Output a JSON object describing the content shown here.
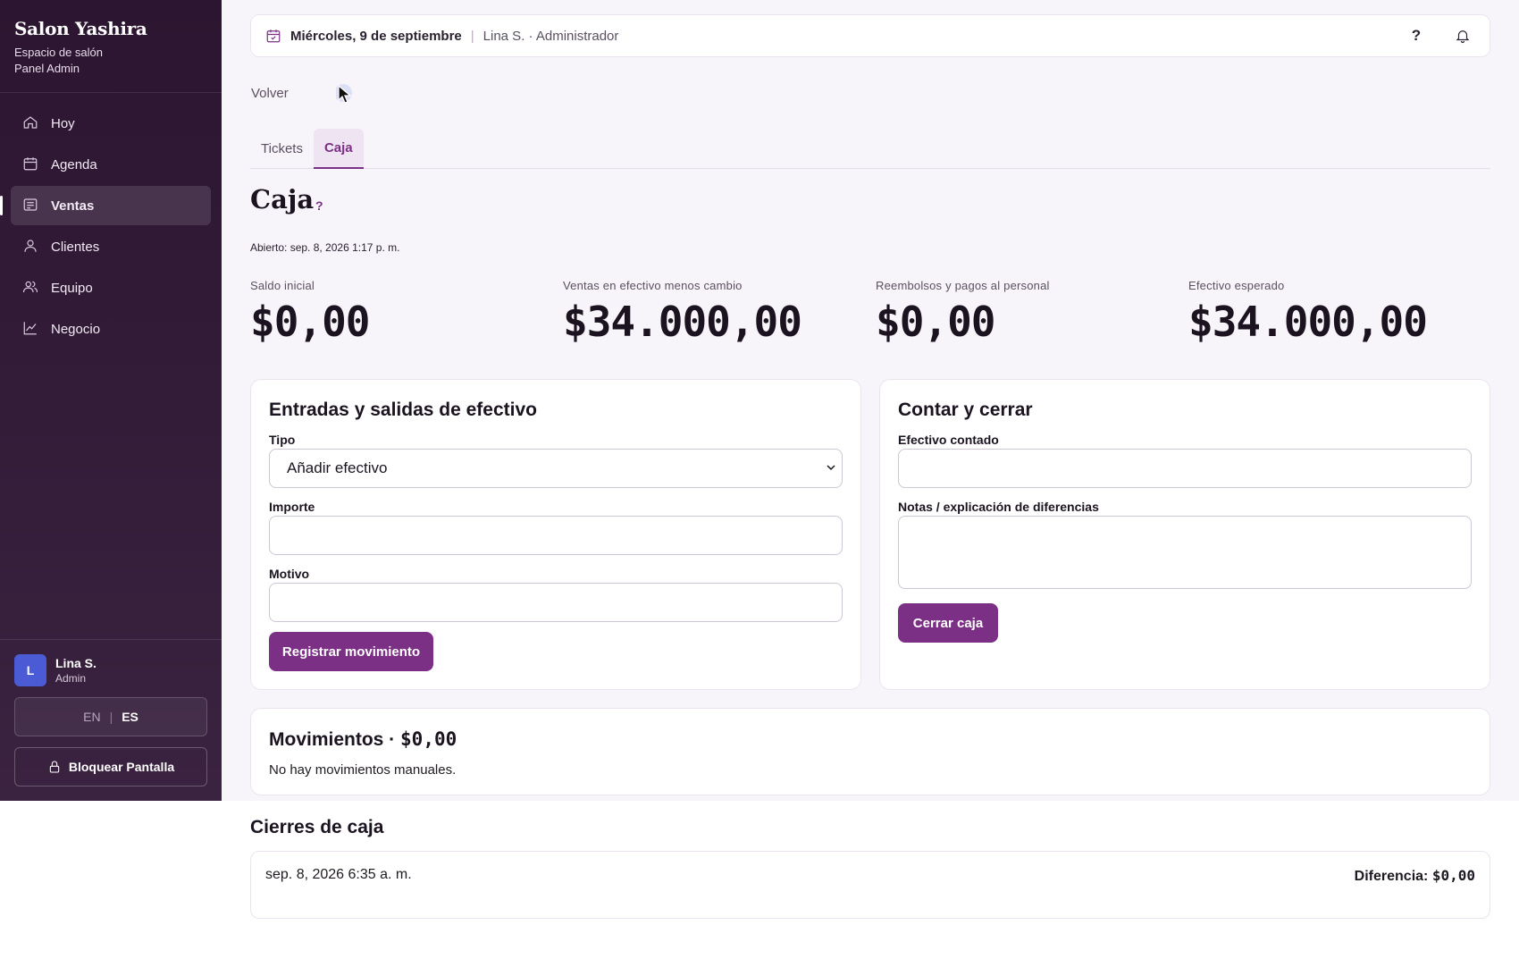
{
  "sidebar": {
    "brand_name": "Salon Yashira",
    "brand_sub1": "Espacio de salón",
    "brand_sub2": "Panel Admin",
    "items": [
      {
        "label": "Hoy",
        "icon": "home-icon"
      },
      {
        "label": "Agenda",
        "icon": "calendar-icon"
      },
      {
        "label": "Ventas",
        "icon": "receipt-icon",
        "active": true
      },
      {
        "label": "Clientes",
        "icon": "user-icon"
      },
      {
        "label": "Equipo",
        "icon": "users-icon"
      },
      {
        "label": "Negocio",
        "icon": "chart-icon"
      }
    ],
    "user": {
      "initial": "L",
      "name": "Lina S.",
      "role": "Admin"
    },
    "lang": {
      "en": "EN",
      "sep": "|",
      "es": "ES"
    },
    "lock_label": "Bloquear Pantalla"
  },
  "topbar": {
    "date": "Miércoles, 9 de septiembre",
    "separator": "|",
    "who": "Lina S. · Administrador",
    "help": "?"
  },
  "nav": {
    "back": "Volver"
  },
  "tabs": [
    {
      "label": "Tickets"
    },
    {
      "label": "Caja",
      "active": true
    }
  ],
  "page": {
    "title": "Caja",
    "help": "?",
    "opened": "Abierto: sep. 8, 2026 1:17 p. m."
  },
  "stats": [
    {
      "label": "Saldo inicial",
      "value": "$0,00"
    },
    {
      "label": "Ventas en efectivo menos cambio",
      "value": "$34.000,00"
    },
    {
      "label": "Reembolsos y pagos al personal",
      "value": "$0,00"
    },
    {
      "label": "Efectivo esperado",
      "value": "$34.000,00"
    }
  ],
  "cash_moves": {
    "title": "Entradas y salidas de efectivo",
    "type_label": "Tipo",
    "type_value": "Añadir efectivo",
    "amount_label": "Importe",
    "amount_value": "",
    "reason_label": "Motivo",
    "reason_value": "",
    "submit": "Registrar movimiento"
  },
  "close_box": {
    "title": "Contar y cerrar",
    "counted_label": "Efectivo contado",
    "counted_value": "",
    "notes_label": "Notas / explicación de diferencias",
    "notes_value": "",
    "submit": "Cerrar caja"
  },
  "movements": {
    "title": "Movimientos ·",
    "total": "$0,00",
    "empty": "No hay movimientos manuales."
  },
  "closures": {
    "title": "Cierres de caja",
    "rows": [
      {
        "date": "sep. 8, 2026 6:35 a. m.",
        "diff_label": "Diferencia:",
        "diff_value": "$0,00"
      }
    ]
  },
  "colors": {
    "accent": "#7b2f85",
    "sidebar": "#2b1530",
    "avatar": "#4b5bd6"
  }
}
